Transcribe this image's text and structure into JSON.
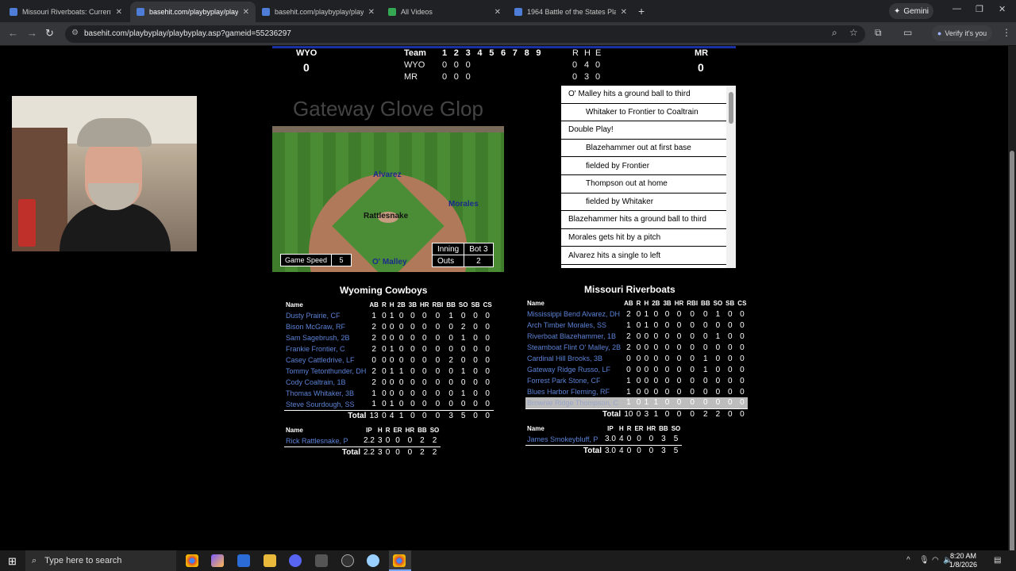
{
  "browser": {
    "tabs": [
      {
        "label": "Missouri Riverboats: Current Se",
        "active": false,
        "icon": "doc-icon"
      },
      {
        "label": "basehit.com/playbyplay/playby",
        "active": true,
        "icon": "doc-icon"
      },
      {
        "label": "basehit.com/playbyplay/playby",
        "active": false,
        "icon": "doc-icon"
      },
      {
        "label": "All Videos",
        "active": false,
        "icon": "play-icon"
      },
      {
        "label": "1964 Battle of the States Playoff",
        "active": false,
        "icon": "doc-icon"
      }
    ],
    "gemini_label": "Gemini",
    "url": "basehit.com/playbyplay/playbyplay.asp?gameid=55236297",
    "verify_label": "Verify it's you"
  },
  "scoreboard": {
    "away_abbr": "WYO",
    "home_abbr": "MR",
    "away_score": "0",
    "home_score": "0",
    "team_header": "Team",
    "innings": [
      "1",
      "2",
      "3",
      "4",
      "5",
      "6",
      "7",
      "8",
      "9"
    ],
    "rhe_header": [
      "R",
      "H",
      "E"
    ],
    "rows": [
      {
        "team": "WYO",
        "innings": [
          "0",
          "0",
          "0"
        ],
        "rhe": [
          "0",
          "4",
          "0"
        ]
      },
      {
        "team": "MR",
        "innings": [
          "0",
          "0",
          "0"
        ],
        "rhe": [
          "0",
          "3",
          "0"
        ]
      }
    ]
  },
  "game_title": "Gateway Glove Glop",
  "field": {
    "players": {
      "cf": "Alvarez",
      "rf": "Morales",
      "pitcher": "Rattlesnake",
      "batter": "O' Malley"
    },
    "game_speed_label": "Game Speed",
    "game_speed_value": "5",
    "inning_label": "Inning",
    "inning_value": "Bot 3",
    "outs_label": "Outs",
    "outs_value": "2"
  },
  "play_by_play": [
    {
      "text": "O' Malley hits a ground ball to third",
      "indent": false
    },
    {
      "text": "Whitaker to Frontier to Coaltrain",
      "indent": true
    },
    {
      "text": "Double Play!",
      "indent": false
    },
    {
      "text": "Blazehammer out at first base",
      "indent": true
    },
    {
      "text": "fielded by Frontier",
      "indent": true
    },
    {
      "text": "Thompson out at home",
      "indent": true
    },
    {
      "text": "fielded by Whitaker",
      "indent": true
    },
    {
      "text": "Blazehammer hits a ground ball to third",
      "indent": false
    },
    {
      "text": "Morales gets hit by a pitch",
      "indent": false
    },
    {
      "text": "Alvarez hits a single to left",
      "indent": false
    }
  ],
  "away_box": {
    "team_name": "Wyoming Cowboys",
    "headers": [
      "Name",
      "AB",
      "R",
      "H",
      "2B",
      "3B",
      "HR",
      "RBI",
      "BB",
      "SO",
      "SB",
      "CS"
    ],
    "rows": [
      {
        "name": "Dusty Prairie, CF",
        "stats": [
          "1",
          "0",
          "1",
          "0",
          "0",
          "0",
          "0",
          "1",
          "0",
          "0",
          "0"
        ]
      },
      {
        "name": "Bison McGraw, RF",
        "stats": [
          "2",
          "0",
          "0",
          "0",
          "0",
          "0",
          "0",
          "0",
          "2",
          "0",
          "0"
        ]
      },
      {
        "name": "Sam Sagebrush, 2B",
        "stats": [
          "2",
          "0",
          "0",
          "0",
          "0",
          "0",
          "0",
          "0",
          "1",
          "0",
          "0"
        ]
      },
      {
        "name": "Frankie Frontier, C",
        "stats": [
          "2",
          "0",
          "1",
          "0",
          "0",
          "0",
          "0",
          "0",
          "0",
          "0",
          "0"
        ]
      },
      {
        "name": "Casey Cattledrive, LF",
        "stats": [
          "0",
          "0",
          "0",
          "0",
          "0",
          "0",
          "0",
          "2",
          "0",
          "0",
          "0"
        ]
      },
      {
        "name": "Tommy Tetonthunder, DH",
        "stats": [
          "2",
          "0",
          "1",
          "1",
          "0",
          "0",
          "0",
          "0",
          "1",
          "0",
          "0"
        ]
      },
      {
        "name": "Cody Coaltrain, 1B",
        "stats": [
          "2",
          "0",
          "0",
          "0",
          "0",
          "0",
          "0",
          "0",
          "0",
          "0",
          "0"
        ]
      },
      {
        "name": "Thomas Whitaker, 3B",
        "stats": [
          "1",
          "0",
          "0",
          "0",
          "0",
          "0",
          "0",
          "0",
          "1",
          "0",
          "0"
        ]
      },
      {
        "name": "Steve Sourdough, SS",
        "stats": [
          "1",
          "0",
          "1",
          "0",
          "0",
          "0",
          "0",
          "0",
          "0",
          "0",
          "0"
        ]
      }
    ],
    "total_label": "Total",
    "totals": [
      "13",
      "0",
      "4",
      "1",
      "0",
      "0",
      "0",
      "3",
      "5",
      "0",
      "0"
    ],
    "pitch_headers": [
      "Name",
      "IP",
      "H",
      "R",
      "ER",
      "HR",
      "BB",
      "SO"
    ],
    "pitchers": [
      {
        "name": "Rick Rattlesnake, P",
        "stats": [
          "2.2",
          "3",
          "0",
          "0",
          "0",
          "2",
          "2"
        ]
      }
    ],
    "pitch_totals": [
      "2.2",
      "3",
      "0",
      "0",
      "0",
      "2",
      "2"
    ]
  },
  "home_box": {
    "team_name": "Missouri Riverboats",
    "headers": [
      "Name",
      "AB",
      "R",
      "H",
      "2B",
      "3B",
      "HR",
      "RBI",
      "BB",
      "SO",
      "SB",
      "CS"
    ],
    "rows": [
      {
        "name": "Mississippi Bend Alvarez, DH",
        "stats": [
          "2",
          "0",
          "1",
          "0",
          "0",
          "0",
          "0",
          "0",
          "1",
          "0",
          "0"
        ]
      },
      {
        "name": "Arch Timber Morales, SS",
        "stats": [
          "1",
          "0",
          "1",
          "0",
          "0",
          "0",
          "0",
          "0",
          "0",
          "0",
          "0"
        ]
      },
      {
        "name": "Riverboat Blazehammer, 1B",
        "stats": [
          "2",
          "0",
          "0",
          "0",
          "0",
          "0",
          "0",
          "0",
          "1",
          "0",
          "0"
        ]
      },
      {
        "name": "Steamboat Flint O' Malley, 2B",
        "stats": [
          "2",
          "0",
          "0",
          "0",
          "0",
          "0",
          "0",
          "0",
          "0",
          "0",
          "0"
        ]
      },
      {
        "name": "Cardinal Hill Brooks, 3B",
        "stats": [
          "0",
          "0",
          "0",
          "0",
          "0",
          "0",
          "0",
          "1",
          "0",
          "0",
          "0"
        ]
      },
      {
        "name": "Gateway Ridge Russo, LF",
        "stats": [
          "0",
          "0",
          "0",
          "0",
          "0",
          "0",
          "0",
          "1",
          "0",
          "0",
          "0"
        ]
      },
      {
        "name": "Forrest Park Stone, CF",
        "stats": [
          "1",
          "0",
          "0",
          "0",
          "0",
          "0",
          "0",
          "0",
          "0",
          "0",
          "0"
        ]
      },
      {
        "name": "Blues Harbor Fleming, RF",
        "stats": [
          "1",
          "0",
          "0",
          "0",
          "0",
          "0",
          "0",
          "0",
          "0",
          "0",
          "0"
        ]
      },
      {
        "name": "Brownie Ridge Thompson, C",
        "stats": [
          "1",
          "0",
          "1",
          "1",
          "0",
          "0",
          "0",
          "0",
          "0",
          "0",
          "0"
        ],
        "highlight": true
      }
    ],
    "total_label": "Total",
    "totals": [
      "10",
      "0",
      "3",
      "1",
      "0",
      "0",
      "0",
      "2",
      "2",
      "0",
      "0"
    ],
    "pitch_headers": [
      "Name",
      "IP",
      "H",
      "R",
      "ER",
      "HR",
      "BB",
      "SO"
    ],
    "pitchers": [
      {
        "name": "James Smokeybluff, P",
        "stats": [
          "3.0",
          "4",
          "0",
          "0",
          "0",
          "3",
          "5"
        ]
      }
    ],
    "pitch_totals": [
      "3.0",
      "4",
      "0",
      "0",
      "0",
      "3",
      "5"
    ]
  },
  "taskbar": {
    "search_placeholder": "Type here to search",
    "time": "8:20 AM",
    "date": "1/8/2026"
  },
  "colors": {
    "link": "#5b82d6",
    "scoreboard_line": "#1a2fa0",
    "field_name": "#1c2a8c"
  }
}
